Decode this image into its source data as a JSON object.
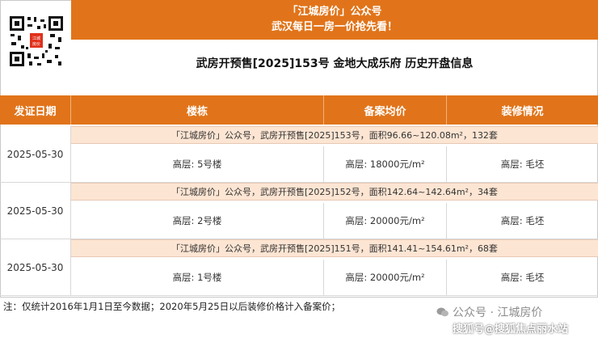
{
  "banner": {
    "line1": "「江城房价」公众号",
    "line2": "武汉每日一房一价抢先看！"
  },
  "qr": {
    "center_label": "江城房价"
  },
  "page_title": "武房开预售[2025]153号 金地大成乐府 历史开盘信息",
  "table": {
    "headers": [
      "发证日期",
      "楼栋",
      "备案均价",
      "装修情况"
    ],
    "rows": [
      {
        "date": "2025-05-30",
        "summary": "「江城房价」公众号，武房开预售[2025]153号，面积96.66~120.08m²，132套",
        "building": "高层: 5号楼",
        "price": "高层: 18000元/m²",
        "decoration": "高层: 毛坯"
      },
      {
        "date": "2025-05-30",
        "summary": "「江城房价」公众号，武房开预售[2025]152号，面积142.64~142.64m²，34套",
        "building": "高层: 2号楼",
        "price": "高层: 20000元/m²",
        "decoration": "高层: 毛坯"
      },
      {
        "date": "2025-05-30",
        "summary": "「江城房价」公众号，武房开预售[2025]151号，面积141.41~154.61m²，68套",
        "building": "高层: 1号楼",
        "price": "高层: 20000元/m²",
        "decoration": "高层: 毛坯"
      }
    ]
  },
  "footnote": "注：仅统计2016年1月1日至今数据；2020年5月25日以后装修价格计入备案价；",
  "watermark": {
    "line1": "公众号 · 江城房价",
    "line2": "搜狐号@搜狐焦点丽水站"
  },
  "colors": {
    "accent": "#e1741a",
    "summary_bg": "#fde5d3"
  }
}
